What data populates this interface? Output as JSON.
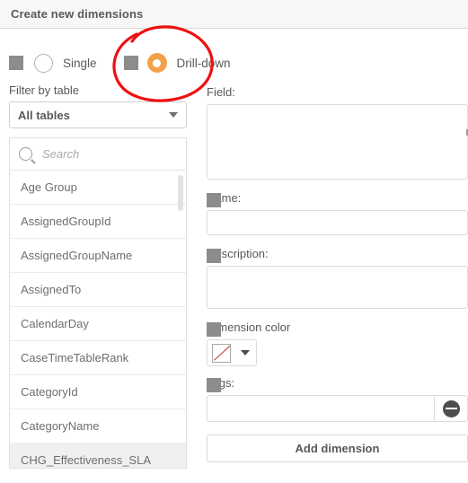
{
  "header": {
    "title": "Create new dimensions"
  },
  "dimension_type": {
    "options": [
      {
        "label": "Single",
        "selected": false,
        "icon": "placeholder-square-icon"
      },
      {
        "label": "Drill-down",
        "selected": true,
        "icon": "placeholder-square-icon"
      }
    ],
    "selected_value": "Drill-down",
    "accent_color": "#f2a14b"
  },
  "left_panel": {
    "filter_label": "Filter by table",
    "filter_selected": "All tables",
    "search_placeholder": "Search",
    "search_value": "",
    "field_items": [
      {
        "label": "Age Group",
        "active": false
      },
      {
        "label": "AssignedGroupId",
        "active": false
      },
      {
        "label": "AssignedGroupName",
        "active": false
      },
      {
        "label": "AssignedTo",
        "active": false
      },
      {
        "label": "CalendarDay",
        "active": false
      },
      {
        "label": "CaseTimeTableRank",
        "active": false
      },
      {
        "label": "CategoryId",
        "active": false
      },
      {
        "label": "CategoryName",
        "active": false
      },
      {
        "label": "CHG_Effectiveness_SLA",
        "active": true
      }
    ]
  },
  "right_panel": {
    "field_label": "Field:",
    "field_value": "",
    "name_label": "Name:",
    "name_value": "",
    "description_label": "Description:",
    "description_value": "",
    "color_label": "Dimension color",
    "color_value": "none",
    "tags_label": "Tags:",
    "tags_value": "",
    "add_button_label": "Add dimension"
  },
  "annotation": {
    "type": "hand-drawn-circle",
    "color": "#ee1111",
    "target": "Drill-down"
  }
}
